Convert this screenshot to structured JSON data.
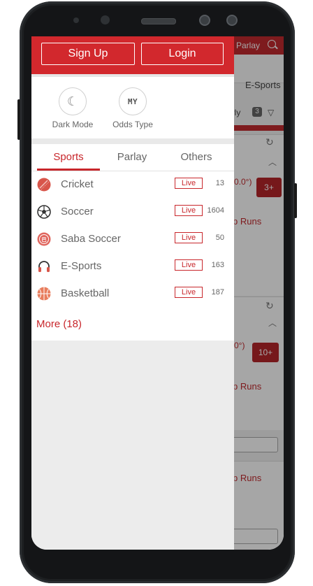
{
  "drawer": {
    "signup_label": "Sign Up",
    "login_label": "Login",
    "settings": [
      {
        "icon": "moon-icon",
        "label": "Dark Mode"
      },
      {
        "icon": "my-odds-icon",
        "icon_text": "MY",
        "label": "Odds Type"
      }
    ],
    "tabs": [
      {
        "label": "Sports",
        "active": true
      },
      {
        "label": "Parlay",
        "active": false
      },
      {
        "label": "Others",
        "active": false
      }
    ],
    "sports": [
      {
        "name": "Cricket",
        "live": "Live",
        "count": "13",
        "icon": "cricket-ball-icon",
        "color": "#d8554a"
      },
      {
        "name": "Soccer",
        "live": "Live",
        "count": "1604",
        "icon": "soccer-ball-icon",
        "color": "#333333"
      },
      {
        "name": "Saba Soccer",
        "live": "Live",
        "count": "50",
        "icon": "saba-soccer-icon",
        "color": "#e0665e"
      },
      {
        "name": "E-Sports",
        "live": "Live",
        "count": "163",
        "icon": "headset-icon",
        "color": "#d8554a"
      },
      {
        "name": "Basketball",
        "live": "Live",
        "count": "187",
        "icon": "basketball-icon",
        "color": "#e87d5d"
      }
    ],
    "more_label": "More (18)"
  },
  "background": {
    "parlay": "Parlay",
    "esports": "E-Sports",
    "filter": "arly",
    "filter_count": "3",
    "card1_odds": "0.0°)",
    "card1_more": "3+",
    "card1_runs": "p Runs",
    "card2_odds": "0°)",
    "card2_more": "10+",
    "card2_runs": "p Runs",
    "card3_runs": "p Runs"
  },
  "colors": {
    "accent": "#d2282d",
    "live": "#c8262b"
  }
}
